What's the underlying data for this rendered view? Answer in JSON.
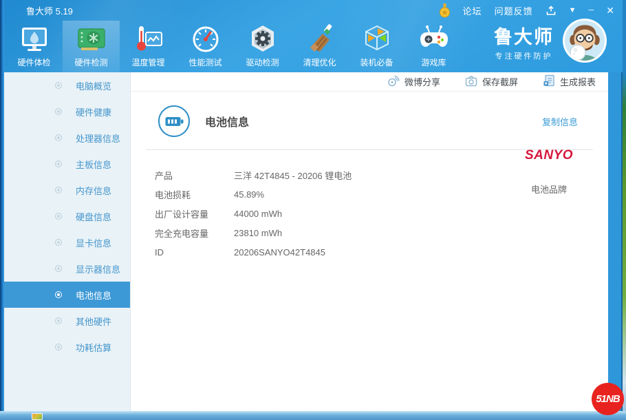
{
  "titlebar": {
    "app_title": "鲁大师 5.19",
    "links": [
      {
        "label": "论坛"
      },
      {
        "label": "问题反馈"
      }
    ],
    "controls": {
      "minimize": "─",
      "close": "✕",
      "dropdown": "▼"
    },
    "medal_icon": "medal-icon",
    "share_icon": "upload-icon"
  },
  "nav": {
    "tabs": [
      {
        "label": "硬件体检",
        "icon": "pc-checkup-icon",
        "active": false
      },
      {
        "label": "硬件检测",
        "icon": "hardware-test-icon",
        "active": true
      },
      {
        "label": "温度管理",
        "icon": "temperature-icon",
        "active": false
      },
      {
        "label": "性能测试",
        "icon": "benchmark-gauge-icon",
        "active": false
      },
      {
        "label": "驱动检测",
        "icon": "driver-gear-icon",
        "active": false
      },
      {
        "label": "清理优化",
        "icon": "cleanup-broom-icon",
        "active": false
      },
      {
        "label": "装机必备",
        "icon": "essentials-cube-icon",
        "active": false
      },
      {
        "label": "游戏库",
        "icon": "gamepad-icon",
        "active": false
      }
    ],
    "brand": {
      "name": "鲁大师",
      "slogan": "专注硬件防护",
      "mascot_icon": "mascot-avatar"
    }
  },
  "toolbar": {
    "buttons": [
      {
        "label": "微博分享",
        "icon": "weibo-icon"
      },
      {
        "label": "保存截屏",
        "icon": "camera-icon"
      },
      {
        "label": "生成报表",
        "icon": "report-icon"
      }
    ]
  },
  "sidebar": {
    "items": [
      {
        "label": "电脑概览",
        "selected": false
      },
      {
        "label": "硬件健康",
        "selected": false
      },
      {
        "label": "处理器信息",
        "selected": false
      },
      {
        "label": "主板信息",
        "selected": false
      },
      {
        "label": "内存信息",
        "selected": false
      },
      {
        "label": "硬盘信息",
        "selected": false
      },
      {
        "label": "显卡信息",
        "selected": false
      },
      {
        "label": "显示器信息",
        "selected": false
      },
      {
        "label": "电池信息",
        "selected": true
      },
      {
        "label": "其他硬件",
        "selected": false
      },
      {
        "label": "功耗估算",
        "selected": false
      }
    ]
  },
  "battery": {
    "title": "电池信息",
    "title_icon": "battery-icon",
    "copy_link": "复制信息",
    "rows": [
      {
        "label": "产品",
        "value": "三洋 42T4845 - 20206 锂电池"
      },
      {
        "label": "电池损耗",
        "value": "45.89%"
      },
      {
        "label": "出厂设计容量",
        "value": "44000 mWh"
      },
      {
        "label": "完全充电容量",
        "value": "23810 mWh"
      },
      {
        "label": "ID",
        "value": "20206SANYO42T4845"
      }
    ],
    "brand": {
      "logo_text": "SANYO",
      "caption": "电池品牌"
    }
  },
  "watermark": {
    "text": "51NB"
  },
  "colors": {
    "chrome_blue": "#2d9bde",
    "selected_blue": "#3d99d6",
    "sidebar_bg": "#e9f2f7",
    "link_blue": "#3a9bd5",
    "sanyo_red": "#d6173c",
    "watermark_red": "#e8231f"
  }
}
